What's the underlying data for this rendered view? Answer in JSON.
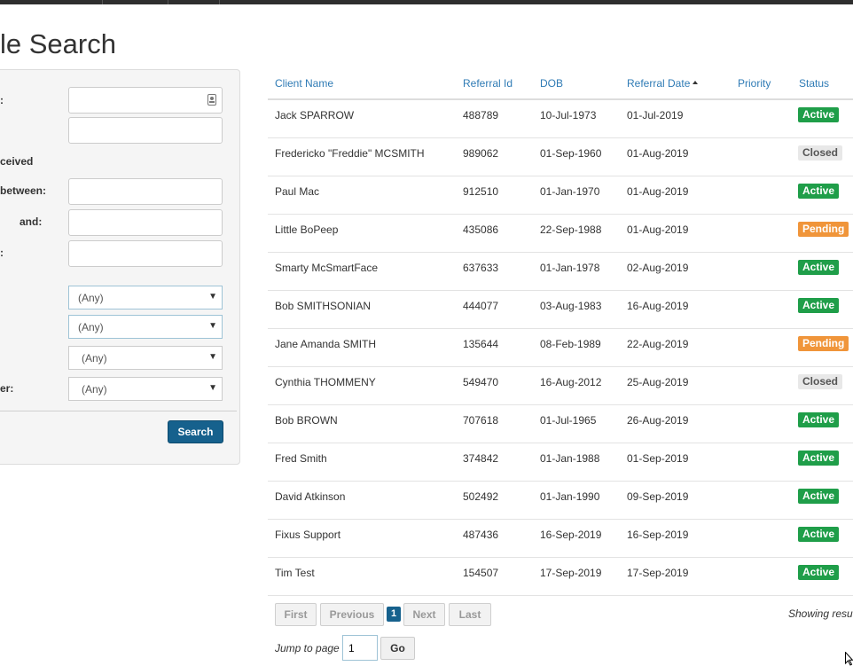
{
  "page": {
    "title": "le Search"
  },
  "search_panel": {
    "labels": {
      "field1": ":",
      "received": "ceived",
      "between": "between:",
      "and": "and:",
      "field6": ":",
      "other": "er:"
    },
    "inputs": {
      "field1_value": "",
      "field2_value": "",
      "between_value": "",
      "and_value": "",
      "field6_value": ""
    },
    "selects": [
      {
        "value": "(Any)"
      },
      {
        "value": "(Any)"
      },
      {
        "value": "(Any)"
      },
      {
        "value": "(Any)"
      }
    ],
    "search_label": "Search"
  },
  "table": {
    "columns": {
      "client_name": "Client Name",
      "referral_id": "Referral Id",
      "dob": "DOB",
      "referral_date": "Referral Date",
      "priority": "Priority",
      "status": "Status"
    },
    "sorted_column": "referral_date",
    "sort_direction": "ascending",
    "rows": [
      {
        "name": "Jack SPARROW",
        "id": "488789",
        "dob": "10-Jul-1973",
        "date": "01-Jul-2019",
        "priority": "",
        "status": "Active"
      },
      {
        "name": "Fredericko \"Freddie\" MCSMITH",
        "id": "989062",
        "dob": "01-Sep-1960",
        "date": "01-Aug-2019",
        "priority": "",
        "status": "Closed"
      },
      {
        "name": "Paul Mac",
        "id": "912510",
        "dob": "01-Jan-1970",
        "date": "01-Aug-2019",
        "priority": "",
        "status": "Active"
      },
      {
        "name": "Little BoPeep",
        "id": "435086",
        "dob": "22-Sep-1988",
        "date": "01-Aug-2019",
        "priority": "",
        "status": "Pending"
      },
      {
        "name": "Smarty McSmartFace",
        "id": "637633",
        "dob": "01-Jan-1978",
        "date": "02-Aug-2019",
        "priority": "",
        "status": "Active"
      },
      {
        "name": "Bob SMITHSONIAN",
        "id": "444077",
        "dob": "03-Aug-1983",
        "date": "16-Aug-2019",
        "priority": "",
        "status": "Active"
      },
      {
        "name": "Jane Amanda SMITH",
        "id": "135644",
        "dob": "08-Feb-1989",
        "date": "22-Aug-2019",
        "priority": "",
        "status": "Pending"
      },
      {
        "name": "Cynthia THOMMENY",
        "id": "549470",
        "dob": "16-Aug-2012",
        "date": "25-Aug-2019",
        "priority": "",
        "status": "Closed"
      },
      {
        "name": "Bob BROWN",
        "id": "707618",
        "dob": "01-Jul-1965",
        "date": "26-Aug-2019",
        "priority": "",
        "status": "Active"
      },
      {
        "name": "Fred Smith",
        "id": "374842",
        "dob": "01-Jan-1988",
        "date": "01-Sep-2019",
        "priority": "",
        "status": "Active"
      },
      {
        "name": "David Atkinson",
        "id": "502492",
        "dob": "01-Jan-1990",
        "date": "09-Sep-2019",
        "priority": "",
        "status": "Active"
      },
      {
        "name": "Fixus Support",
        "id": "487436",
        "dob": "16-Sep-2019",
        "date": "16-Sep-2019",
        "priority": "",
        "status": "Active"
      },
      {
        "name": "Tim Test",
        "id": "154507",
        "dob": "17-Sep-2019",
        "date": "17-Sep-2019",
        "priority": "",
        "status": "Active"
      }
    ]
  },
  "pagination": {
    "first": "First",
    "previous": "Previous",
    "current_page": "1",
    "next": "Next",
    "last": "Last",
    "showing": "Showing resu",
    "jump_label": "Jump to page",
    "jump_value": "1",
    "go_label": "Go"
  },
  "colors": {
    "link_blue": "#2f7bb5",
    "primary_button": "#16618d",
    "status_active": "#1f9e49",
    "status_closed": "#e8e8e8",
    "status_pending": "#f0953a"
  }
}
